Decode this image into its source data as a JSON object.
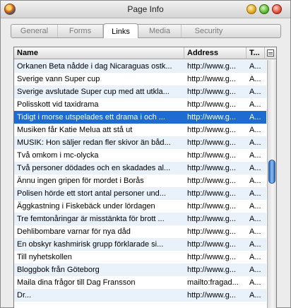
{
  "window": {
    "title": "Page Info"
  },
  "tabs": [
    "General",
    "Forms",
    "Links",
    "Media",
    "Security"
  ],
  "active_tab": "Links",
  "table": {
    "columns": {
      "name": "Name",
      "address": "Address",
      "type": "T..."
    },
    "rows": [
      {
        "name": "Orkanen Beta nådde i dag Nicaraguas ostk...",
        "address": "http://www.g...",
        "type": "A..."
      },
      {
        "name": "Sverige vann Super cup",
        "address": "http://www.g...",
        "type": "A..."
      },
      {
        "name": "Sverige avslutade Super cup med att utkla...",
        "address": "http://www.g...",
        "type": "A..."
      },
      {
        "name": "Polisskott vid taxidrama",
        "address": "http://www.g...",
        "type": "A..."
      },
      {
        "name": "Tidigt i morse utspelades ett drama i och ...",
        "address": "http://www.g...",
        "type": "A..."
      },
      {
        "name": "Musiken får Katie Melua att stå ut",
        "address": "http://www.g...",
        "type": "A..."
      },
      {
        "name": "MUSIK: Hon säljer redan fler skivor än båd...",
        "address": "http://www.g...",
        "type": "A..."
      },
      {
        "name": "Två omkom i mc-olycka",
        "address": "http://www.g...",
        "type": "A..."
      },
      {
        "name": "Två personer dödades och en skadades al...",
        "address": "http://www.g...",
        "type": "A..."
      },
      {
        "name": "Ännu ingen gripen för mordet i Borås",
        "address": "http://www.g...",
        "type": "A..."
      },
      {
        "name": "Polisen hörde ett stort antal personer und...",
        "address": "http://www.g...",
        "type": "A..."
      },
      {
        "name": "Äggkastning i Fiskebäck under lördagen",
        "address": "http://www.g...",
        "type": "A..."
      },
      {
        "name": "Tre femtonåringar är misstänkta för brott ...",
        "address": "http://www.g...",
        "type": "A..."
      },
      {
        "name": "Dehlibombare varnar för nya dåd",
        "address": "http://www.g...",
        "type": "A..."
      },
      {
        "name": "En obskyr kashmirisk grupp förklarade si...",
        "address": "http://www.g...",
        "type": "A..."
      },
      {
        "name": "Till nyhetskollen",
        "address": "http://www.g...",
        "type": "A..."
      },
      {
        "name": "Bloggbok från Göteborg",
        "address": "http://www.g...",
        "type": "A..."
      },
      {
        "name": "Maila dina frågor till Dag Fransson",
        "address": "mailto:fragad...",
        "type": "A..."
      },
      {
        "name": "Dr...",
        "address": "http://www.g...",
        "type": "A..."
      }
    ],
    "selected_index": 4
  },
  "colors": {
    "selection": "#1c6cd1",
    "stripe": "#e9f1fb",
    "scroll_thumb": "#2e67b8"
  }
}
